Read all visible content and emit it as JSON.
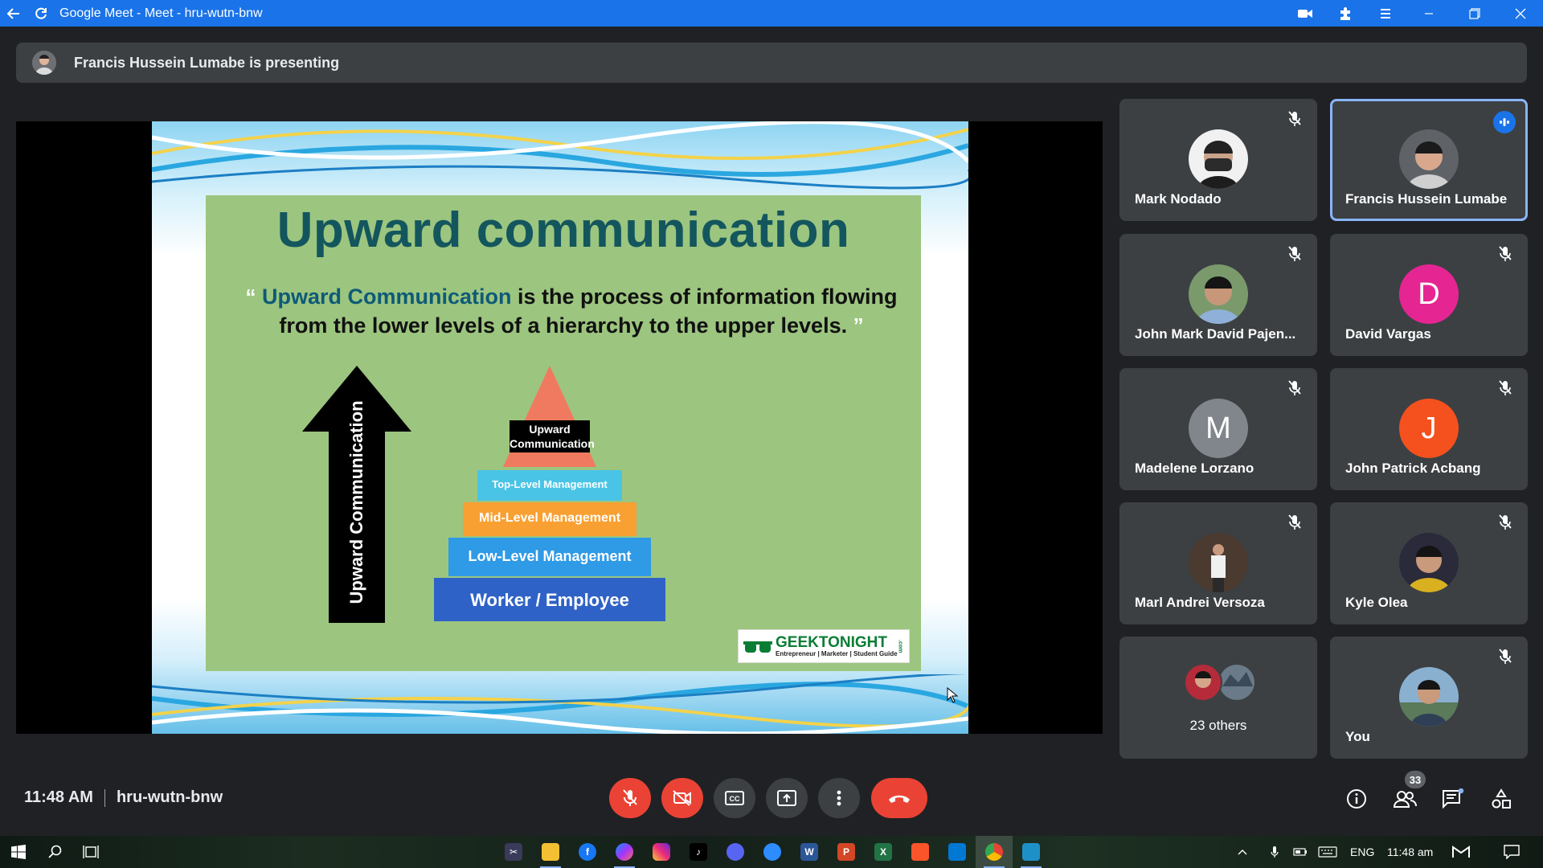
{
  "window": {
    "title": "Google Meet - Meet - hru-wutn-bnw"
  },
  "banner": {
    "text": "Francis Hussein Lumabe is presenting"
  },
  "slide": {
    "title": "Upward communication",
    "quote_open": "“",
    "quote_highlight": "Upward Communication",
    "quote_line1_rest": " is the process of information flowing",
    "quote_line2": "from the lower levels of a hierarchy to the upper levels.",
    "quote_close": "”",
    "arrow_label": "Upward Communication",
    "pyramid": {
      "top": "Upward Communication",
      "levels": [
        "Top-Level Management",
        "Mid-Level Management",
        "Low-Level Management",
        "Worker / Employee"
      ],
      "colors": [
        "#f07a5f",
        "#49c4e6",
        "#f8a032",
        "#2f9ae6",
        "#2f62c6"
      ]
    },
    "logo_text": "GEEKTONIGHT",
    "logo_tagline": "Entrepreneur | Marketer | Student Guide",
    "logo_side": ".com"
  },
  "participants": [
    {
      "name": "Mark Nodado",
      "avatar": "photo",
      "muted": true
    },
    {
      "name": "Francis Hussein Lumabe",
      "avatar": "photo",
      "speaking": true
    },
    {
      "name": "John Mark David Pajen...",
      "avatar": "photo",
      "muted": true
    },
    {
      "name": "David Vargas",
      "initial": "D",
      "color": "#e52592",
      "muted": true
    },
    {
      "name": "Madelene Lorzano",
      "initial": "M",
      "color": "#80868b",
      "muted": true
    },
    {
      "name": "John Patrick Acbang",
      "initial": "J",
      "color": "#f4511e",
      "muted": true
    },
    {
      "name": "Marl Andrei Versoza",
      "avatar": "photo",
      "muted": true
    },
    {
      "name": "Kyle Olea",
      "avatar": "photo",
      "muted": true
    },
    {
      "name": "23 others",
      "avatar": "group"
    },
    {
      "name": "You",
      "avatar": "photo",
      "muted": true
    }
  ],
  "meeting": {
    "time": "11:48 AM",
    "code": "hru-wutn-bnw",
    "people_count": "33"
  },
  "colors": {
    "accent": "#1a73e8",
    "danger": "#ea4335",
    "tile": "#3c4043",
    "background": "#202124"
  },
  "taskbar": {
    "lang": "ENG",
    "time": "11:48 am",
    "apps": [
      "snip",
      "file-explorer",
      "facebook",
      "messenger",
      "instagram",
      "tiktok",
      "discord",
      "zoom",
      "word",
      "powerpoint",
      "excel",
      "brave",
      "vscode",
      "chrome",
      "photos"
    ]
  }
}
